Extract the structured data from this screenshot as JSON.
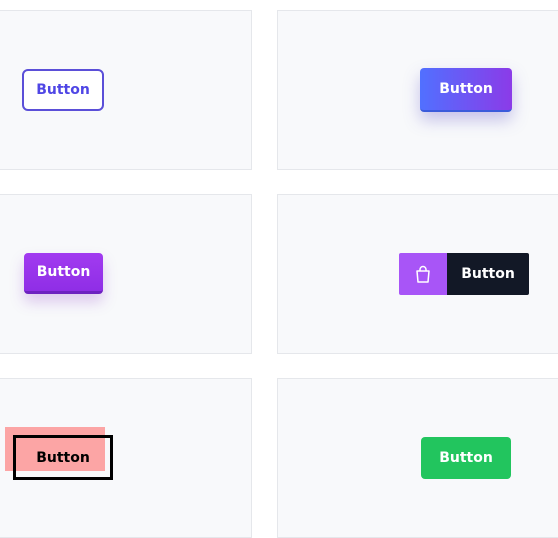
{
  "buttons": {
    "outline": {
      "label": "Button"
    },
    "gradient": {
      "label": "Button"
    },
    "purple_3d": {
      "label": "Button"
    },
    "icon_split": {
      "label": "Button",
      "icon": "shopping-bag-icon"
    },
    "offset_pink": {
      "label": "Button"
    },
    "green": {
      "label": "Button"
    }
  },
  "colors": {
    "card_bg": "#f8f9fb",
    "card_border": "#e5e7eb",
    "outline_border": "#5b4fd8",
    "gradient_start": "#5170ff",
    "gradient_end": "#8b3be8",
    "purple": "#9333ea",
    "bag_bg": "#a855f7",
    "dark": "#121826",
    "pink": "#fca5a5",
    "green": "#22c55e"
  }
}
